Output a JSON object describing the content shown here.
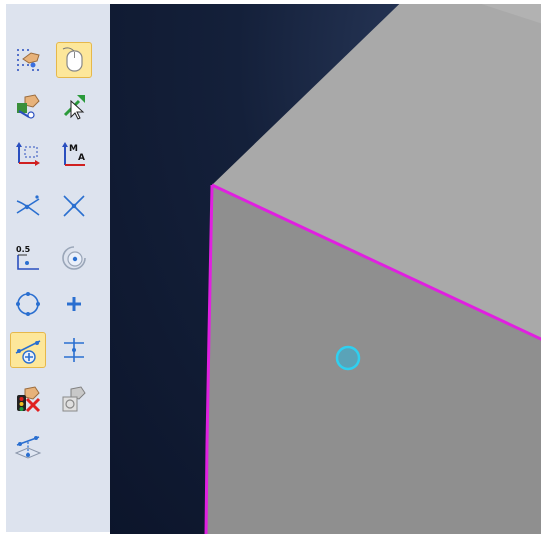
{
  "toolbar": {
    "tools": [
      {
        "icon": "grid-datum-icon"
      },
      {
        "icon": "mouse-select-icon",
        "active": true
      },
      {
        "icon": "query-feature-icon"
      },
      {
        "icon": "pick-arrow-icon"
      },
      {
        "icon": "create-axis-icon"
      },
      {
        "icon": "datum-axis-label-icon",
        "label": "M A"
      },
      {
        "icon": "intersection-point-icon"
      },
      {
        "icon": "cross-point-icon"
      },
      {
        "icon": "offset-point-icon",
        "label": "0.5"
      },
      {
        "icon": "concentric-point-icon"
      },
      {
        "icon": "circle-center-icon"
      },
      {
        "icon": "point-icon"
      },
      {
        "icon": "point-on-edge-icon",
        "active": true
      },
      {
        "icon": "midpoint-icon"
      },
      {
        "icon": "delete-feature-icon"
      },
      {
        "icon": "feature-manager-icon"
      },
      {
        "icon": "project-point-icon"
      }
    ]
  },
  "colors": {
    "toolbar_bg": "#dde3ee",
    "active_tool": "#fde79a",
    "edge_highlight": "#e020e0",
    "selected_point": "#2fb4d8",
    "face_top": "#a9a9a9",
    "face_front": "#8f8f8f"
  }
}
